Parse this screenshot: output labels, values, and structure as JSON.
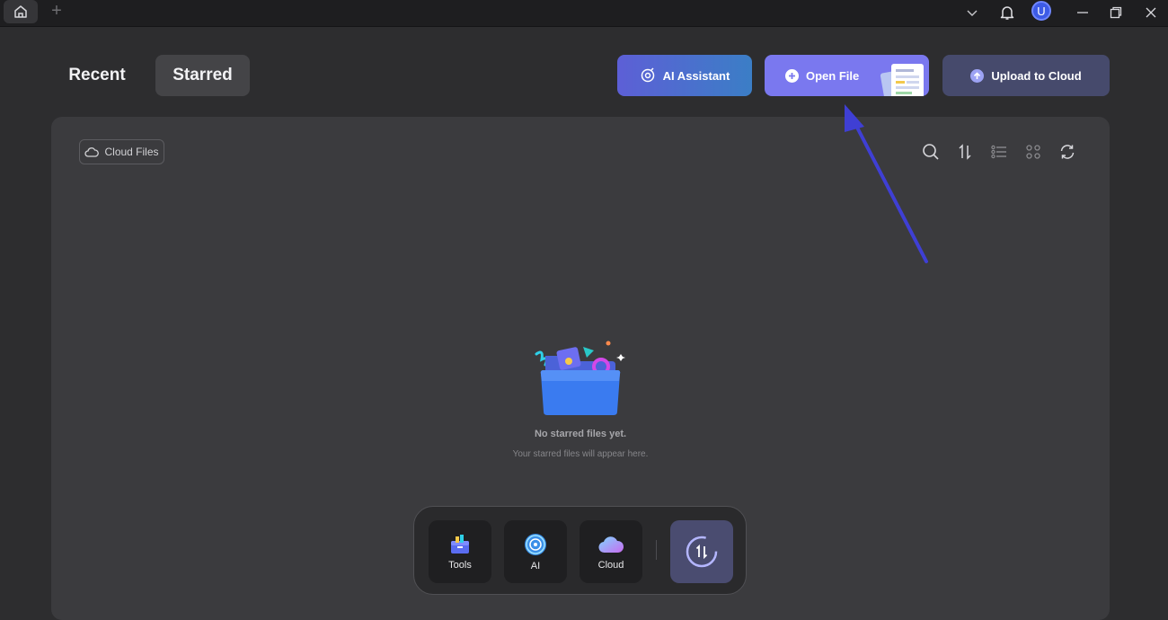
{
  "titlebar": {
    "new_tab_glyph": "+"
  },
  "header": {
    "tabs": [
      {
        "label": "Recent"
      },
      {
        "label": "Starred"
      }
    ],
    "active_tab": "Starred"
  },
  "actions": {
    "ai_assistant": "AI Assistant",
    "open_file": "Open File",
    "upload_cloud": "Upload to Cloud"
  },
  "panel": {
    "cloud_files_label": "Cloud Files",
    "toolbar_icons": [
      "search-icon",
      "sort-icon",
      "list-view-icon",
      "grid-view-icon",
      "refresh-icon"
    ],
    "empty_title": "No starred files yet.",
    "empty_subtitle": "Your starred files will appear here."
  },
  "dock": {
    "items": [
      {
        "label": "Tools"
      },
      {
        "label": "AI"
      },
      {
        "label": "Cloud"
      }
    ]
  },
  "colors": {
    "accent": "#7a78ef",
    "arrow": "#3f3fd4",
    "background": "#2d2d2f",
    "panel": "#3b3b3e"
  }
}
